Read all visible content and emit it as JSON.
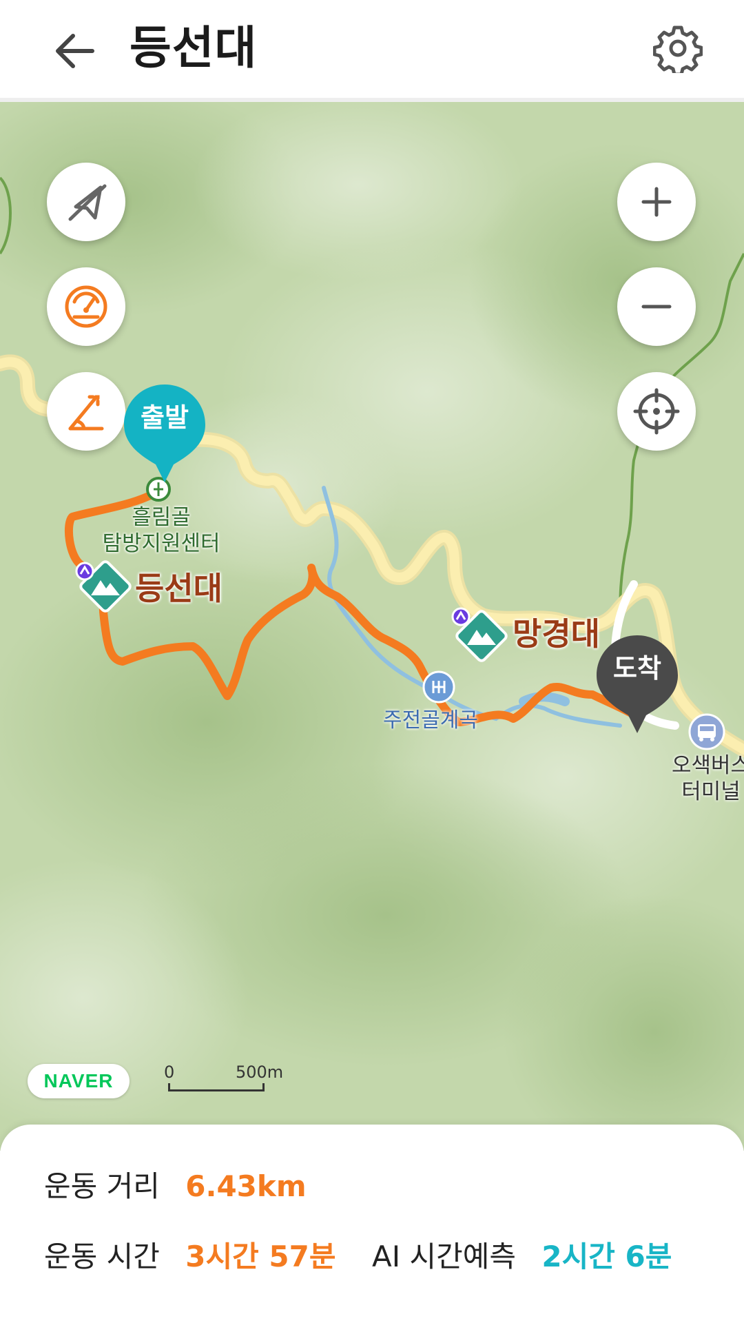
{
  "header": {
    "title": "등선대"
  },
  "map": {
    "pins": {
      "start_label": "출발",
      "end_label": "도착"
    },
    "labels": {
      "trailhead_line1": "흘림골",
      "trailhead_line2": "탐방지원센터",
      "peak1": "등선대",
      "peak2": "망경대",
      "valley": "주전골계곡",
      "bus_line1": "오색버스",
      "bus_line2": "터미널"
    },
    "attribution": "NAVER",
    "scale": {
      "zero": "0",
      "max": "500m"
    },
    "icons": [
      "back-arrow-icon",
      "gear-icon",
      "compass-off-icon",
      "speedometer-icon",
      "elevation-icon",
      "zoom-in-icon",
      "zoom-out-icon",
      "locate-icon",
      "mountain-peak-icon",
      "restaurant-icon",
      "bus-icon",
      "trailhead-icon"
    ],
    "colors": {
      "route": "#f47b20",
      "start_pin": "#14b3c4",
      "end_pin": "#4a4a4a",
      "peak_badge": "#2e9e8c",
      "road": "#fbe9a6"
    }
  },
  "stats": {
    "distance_label": "운동 거리",
    "distance_value": "6.43km",
    "time_label": "운동 시간",
    "time_value": "3시간 57분",
    "ai_label": "AI 시간예측",
    "ai_value": "2시간 6분"
  }
}
